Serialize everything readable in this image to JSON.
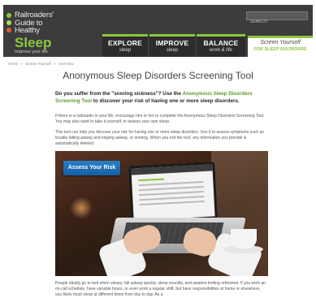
{
  "header": {
    "logo": {
      "line1": "Railroaders'",
      "line2": "Guide to",
      "line3": "Healthy",
      "line4": "Sleep",
      "tagline": "Improve your life"
    },
    "search_placeholder": "SEARCH",
    "nav": [
      {
        "title": "EXPLORE",
        "sub": "sleep"
      },
      {
        "title": "IMPROVE",
        "sub": "sleep"
      },
      {
        "title": "BALANCE",
        "sub": "work & life"
      }
    ],
    "screen_tab": {
      "line1": "Screen Yourself",
      "line2": "FOR SLEEP DISORDERS"
    },
    "colors": {
      "accent": "#8cc63f",
      "header_bg": "#3c3c3c",
      "dot1": "#8cc63f",
      "dot2": "#b7d957",
      "dot3": "#e35c2d"
    }
  },
  "breadcrumb": [
    "Home",
    ">",
    "Screen Yourself",
    ">",
    "Overview"
  ],
  "page": {
    "title": "Anonymous Sleep Disorders Screening Tool",
    "lead_text": "Do you suffer from the \"snoring sickness\"? Use the",
    "lead_link": "Anonymous Sleep Disorders Screening Tool",
    "lead_end": "to discover your risk of having one or more sleep disorders.",
    "p1": "If there is a railroader in your life, encourage him or her to complete the Anonymous Sleep Disorders Screening Tool. You may also want to take it yourself, to assess your own sleep.",
    "p2": "This tool can help you discover your risk for having one or more sleep disorders. Use it to assess symptoms such as trouble falling asleep and staying asleep, or snoring. When you exit the tool, any information you provide is automatically deleted.",
    "assess_button": "Assess Your Risk",
    "p3": "People ideally go to bed when sleepy, fall asleep quickly, sleep soundly, and awaken feeling refreshed. If you work an on-call schedule, have variable hours, or even work a regular shift, but have responsibilities at home or elsewhere, you likely must sleep at different times from day to day. As a"
  }
}
